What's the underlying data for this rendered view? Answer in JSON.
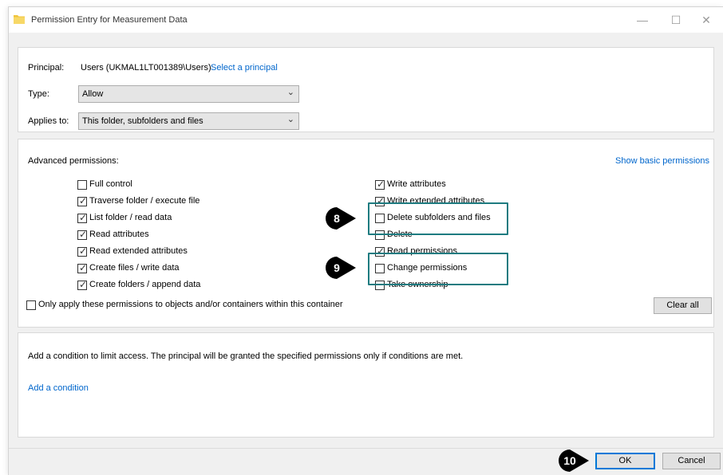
{
  "window": {
    "title": "Permission Entry for Measurement Data",
    "minimize": "—",
    "maximize": "☐",
    "close": "✕"
  },
  "principal": {
    "label": "Principal:",
    "value": "Users (UKMAL1LT001389\\Users)",
    "select_link": "Select a principal"
  },
  "type": {
    "label": "Type:",
    "value": "Allow"
  },
  "applies_to": {
    "label": "Applies to:",
    "value": "This folder, subfolders and files"
  },
  "advanced": {
    "heading": "Advanced permissions:",
    "show_basic_link": "Show basic permissions",
    "left": [
      {
        "label": "Full control",
        "checked": false
      },
      {
        "label": "Traverse folder / execute file",
        "checked": true
      },
      {
        "label": "List folder / read data",
        "checked": true
      },
      {
        "label": "Read attributes",
        "checked": true
      },
      {
        "label": "Read extended attributes",
        "checked": true
      },
      {
        "label": "Create files / write data",
        "checked": true
      },
      {
        "label": "Create folders / append data",
        "checked": true
      }
    ],
    "right": [
      {
        "label": "Write attributes",
        "checked": true
      },
      {
        "label": "Write extended attributes",
        "checked": true
      },
      {
        "label": "Delete subfolders and files",
        "checked": false
      },
      {
        "label": "Delete",
        "checked": false
      },
      {
        "label": "Read permissions",
        "checked": true
      },
      {
        "label": "Change permissions",
        "checked": false
      },
      {
        "label": "Take ownership",
        "checked": false
      }
    ],
    "only_apply": {
      "label": "Only apply these permissions to objects and/or containers within this container",
      "checked": false
    },
    "clear_all": "Clear all"
  },
  "condition": {
    "description": "Add a condition to limit access. The principal will be granted the specified permissions only if conditions are met.",
    "add_link": "Add a condition"
  },
  "footer": {
    "ok": "OK",
    "cancel": "Cancel"
  },
  "markers": {
    "m8": "8",
    "m9": "9",
    "m10": "10"
  },
  "colors": {
    "highlight": "#1e7b80",
    "link": "#0066cc",
    "marker": "#000000",
    "ok_border": "#0078d7"
  }
}
